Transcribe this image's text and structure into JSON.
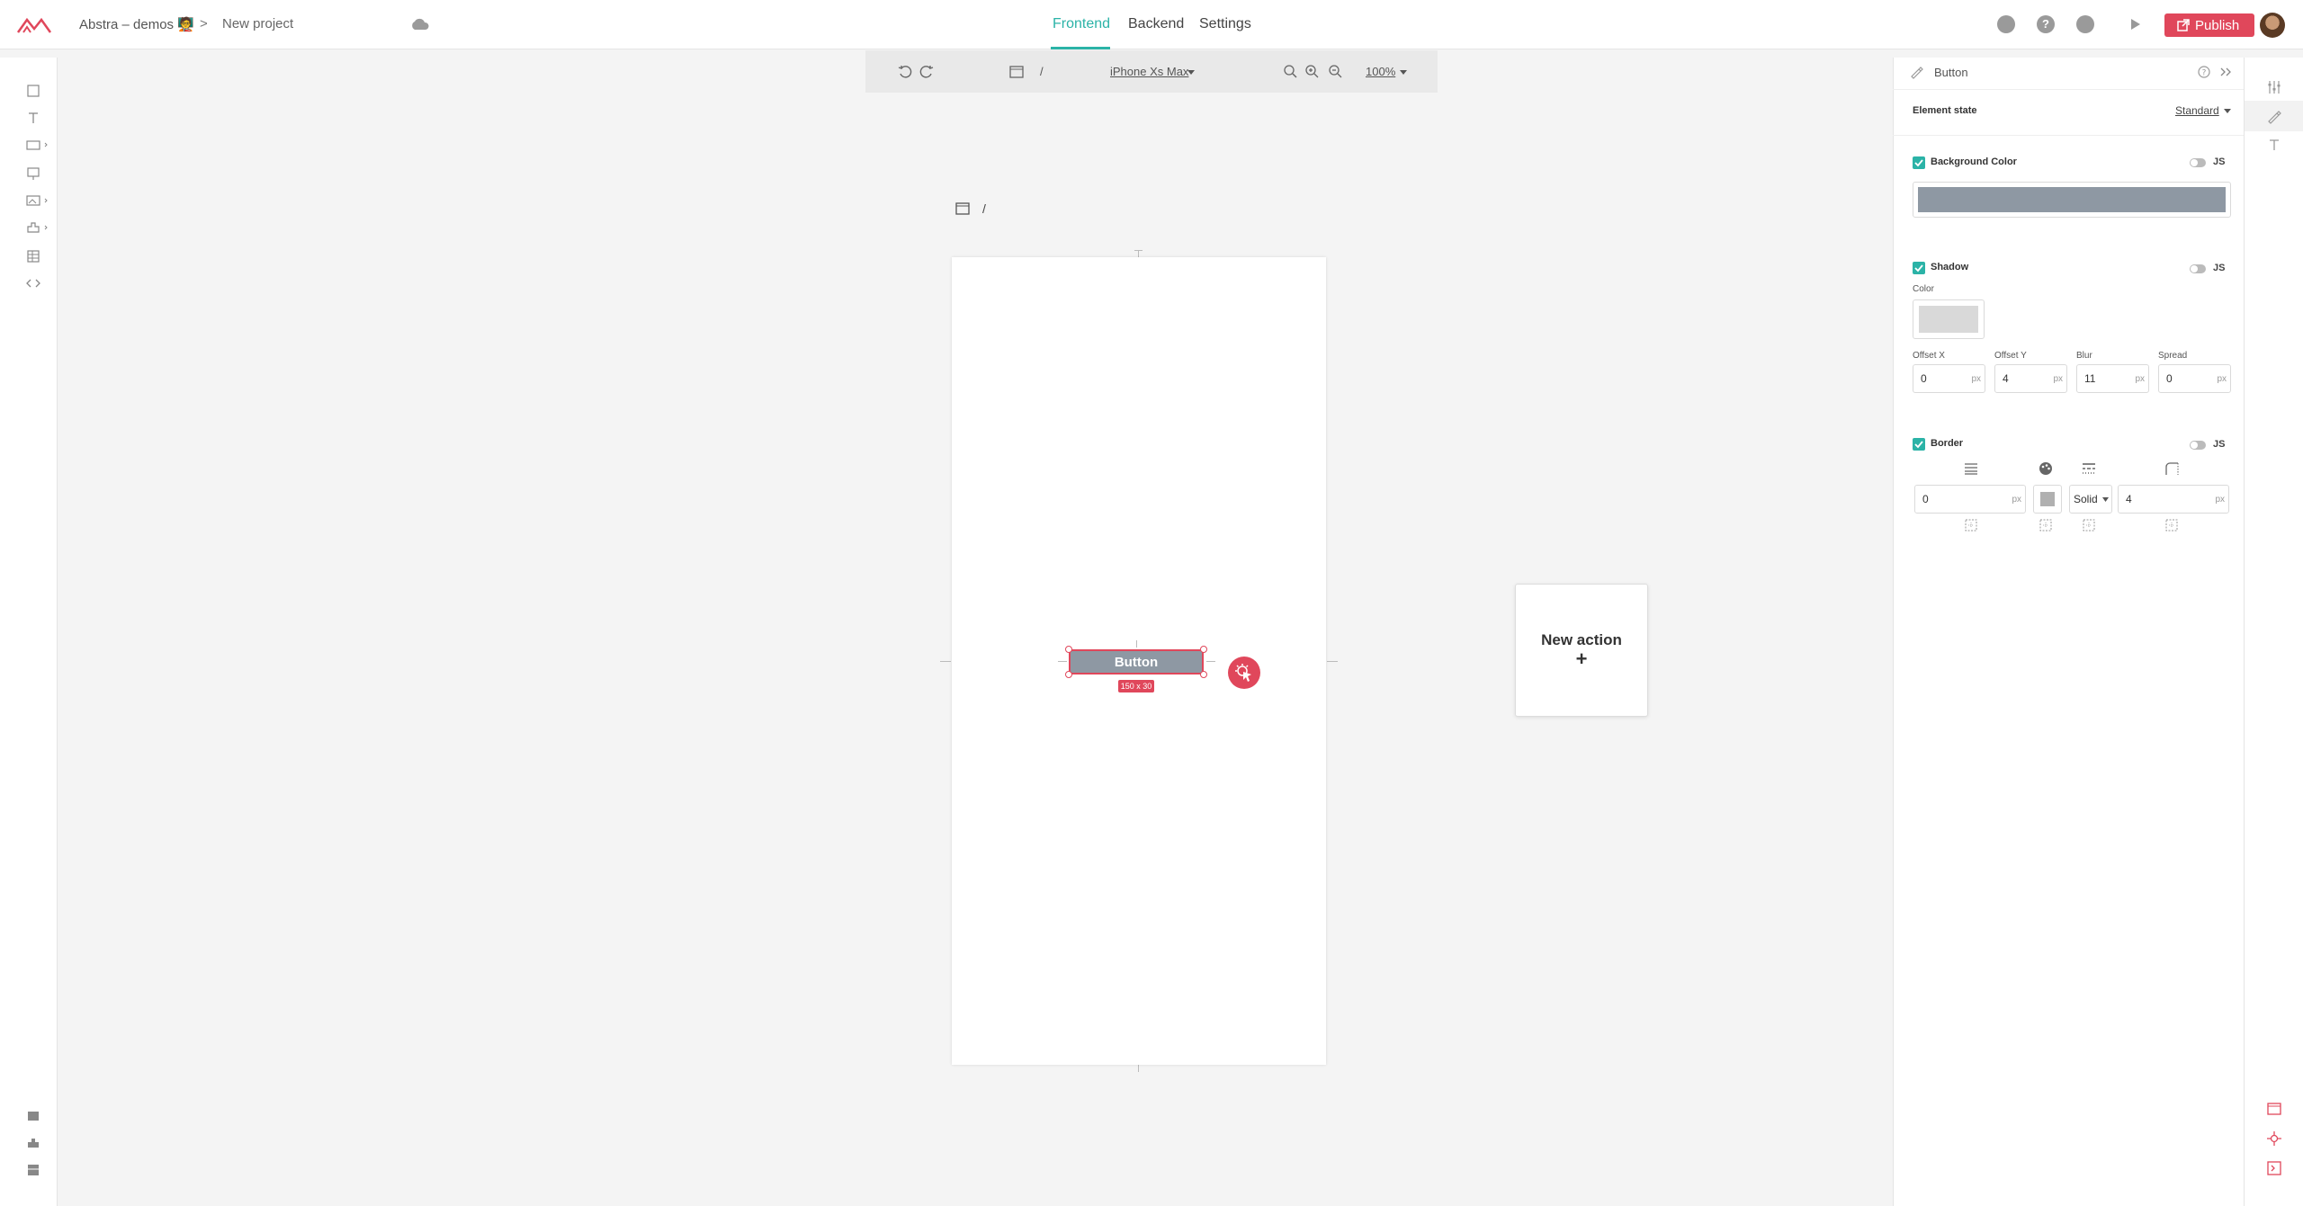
{
  "header": {
    "project_name": "Abstra – demos 🧑‍🏫",
    "separator": ">",
    "page_name": "New project",
    "tabs": [
      {
        "label": "Frontend",
        "active": true
      },
      {
        "label": "Backend",
        "active": false
      },
      {
        "label": "Settings",
        "active": false
      }
    ],
    "publish_label": "Publish",
    "accent": "#2bb3a7",
    "brand": "#e0475b"
  },
  "left_toolbar": {
    "tools": [
      "container-icon",
      "text-icon",
      "input-icon",
      "display-icon",
      "image-icon",
      "plugins-icon",
      "table-icon",
      "code-icon"
    ],
    "bottom": [
      "pages-icon",
      "components-icon",
      "layers-icon"
    ]
  },
  "canvas_toolbar": {
    "path": "/",
    "device": "iPhone Xs Max",
    "zoom": "100%"
  },
  "canvas": {
    "frame_path": "/",
    "button_label": "Button",
    "size_badge": "150 x 30",
    "new_action_label": "New action",
    "new_action_plus": "+"
  },
  "properties": {
    "title": "Button",
    "element_state_label": "Element state",
    "element_state_value": "Standard",
    "background": {
      "label": "Background Color",
      "js": "JS",
      "color": "#8e98a3"
    },
    "shadow": {
      "label": "Shadow",
      "js": "JS",
      "color_label": "Color",
      "color": "#d9d9d9",
      "fields": [
        {
          "label": "Offset X",
          "value": "0",
          "unit": "px"
        },
        {
          "label": "Offset Y",
          "value": "4",
          "unit": "px"
        },
        {
          "label": "Blur",
          "value": "11",
          "unit": "px"
        },
        {
          "label": "Spread",
          "value": "0",
          "unit": "px"
        }
      ]
    },
    "border": {
      "label": "Border",
      "js": "JS",
      "width": "0",
      "width_unit": "px",
      "style": "Solid",
      "radius": "4",
      "radius_unit": "px"
    }
  }
}
